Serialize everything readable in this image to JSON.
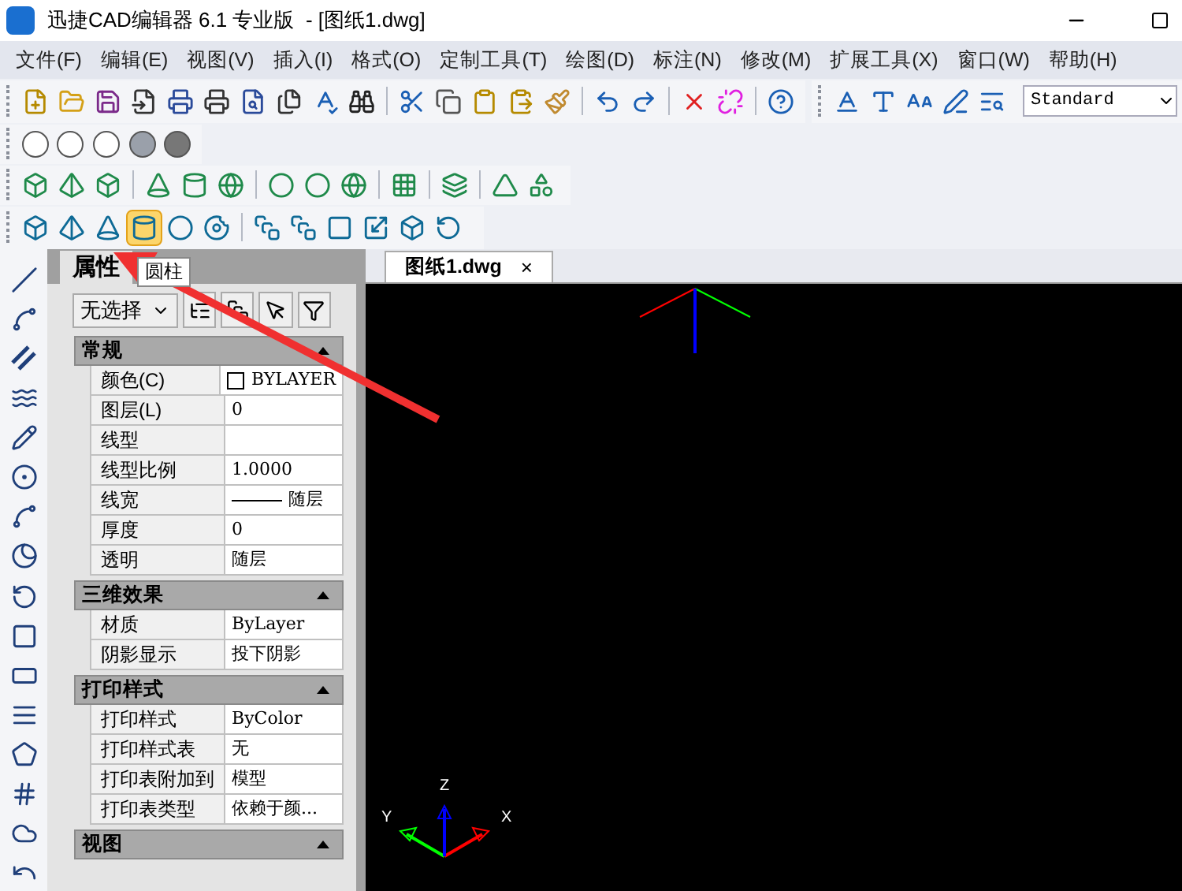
{
  "window": {
    "title": "迅捷CAD编辑器 6.1 专业版  - [图纸1.dwg]"
  },
  "menu": [
    "文件(F)",
    "编辑(E)",
    "视图(V)",
    "插入(I)",
    "格式(O)",
    "定制工具(T)",
    "绘图(D)",
    "标注(N)",
    "修改(M)",
    "扩展工具(X)",
    "窗口(W)",
    "帮助(H)"
  ],
  "text_style_select": {
    "value": "Standard"
  },
  "solid_toolbar": [
    {
      "selected": false
    },
    {
      "selected": false
    },
    {
      "selected": false
    },
    {
      "selected": true
    },
    {
      "selected": false
    },
    {
      "selected": false
    },
    {
      "selected": false
    },
    {
      "selected": false
    },
    {
      "selected": false
    },
    {
      "selected": false
    },
    {
      "selected": false
    },
    {
      "selected": false
    }
  ],
  "tooltip": "圆柱",
  "properties": {
    "title": "属性",
    "selection": "无选择",
    "sections": [
      {
        "title": "常规",
        "rows": [
          {
            "name": "颜色(C)",
            "value": "BYLAYER",
            "kind": "color"
          },
          {
            "name": "图层(L)",
            "value": "0",
            "kind": "text"
          },
          {
            "name": "线型",
            "value": "",
            "kind": "text"
          },
          {
            "name": "线型比例",
            "value": "1.0000",
            "kind": "text"
          },
          {
            "name": "线宽",
            "value": "随层",
            "kind": "lineweight"
          },
          {
            "name": "厚度",
            "value": "0",
            "kind": "text"
          },
          {
            "name": "透明",
            "value": "随层",
            "kind": "text"
          }
        ]
      },
      {
        "title": "三维效果",
        "rows": [
          {
            "name": "材质",
            "value": "ByLayer",
            "kind": "text"
          },
          {
            "name": "阴影显示",
            "value": "投下阴影",
            "kind": "text"
          }
        ]
      },
      {
        "title": "打印样式",
        "rows": [
          {
            "name": "打印样式",
            "value": "ByColor",
            "kind": "text"
          },
          {
            "name": "打印样式表",
            "value": "无",
            "kind": "text"
          },
          {
            "name": "打印表附加到",
            "value": "模型",
            "kind": "text"
          },
          {
            "name": "打印表类型",
            "value": "依赖于颜...",
            "kind": "text"
          }
        ]
      },
      {
        "title": "视图"
      }
    ]
  },
  "drawing_tab": {
    "label": "图纸1.dwg",
    "close": "×"
  },
  "ucs_axes": {
    "x": "X",
    "y": "Y",
    "z": "Z"
  }
}
